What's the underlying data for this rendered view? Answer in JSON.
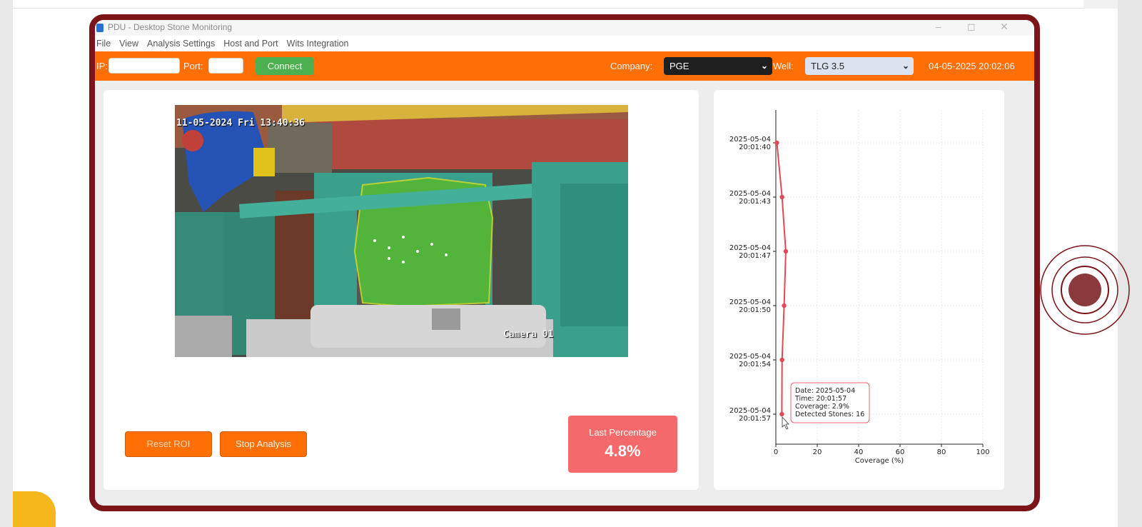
{
  "window": {
    "title": "PDU - Desktop Stone Monitoring"
  },
  "menu": [
    "File",
    "View",
    "Analysis Settings",
    "Host and Port",
    "Wits Integration"
  ],
  "connection": {
    "ip_label": "IP:",
    "ip_value": "",
    "port_label": "Port:",
    "port_value": "",
    "connect_label": "Connect"
  },
  "company": {
    "label": "Company:",
    "value": "PGE"
  },
  "well": {
    "label": "Well:",
    "value": "TLG 3.5"
  },
  "datetime": "04-05-2025 20:02:06",
  "camera": {
    "timestamp": "11-05-2024 Fri 13:40:36",
    "label": "Camera 01"
  },
  "buttons": {
    "reset_roi": "Reset ROI",
    "stop_analysis": "Stop Analysis"
  },
  "last_percentage": {
    "title": "Last Percentage",
    "value": "4.8%"
  },
  "colors": {
    "toolbar": "#ff6f06",
    "frame": "#7a1418",
    "connect": "#4caf50",
    "last_pct": "#f46a6a",
    "line": "#e04a55"
  },
  "chart_data": {
    "type": "line",
    "orientation": "horizontal-time-vertical",
    "xlabel": "Coverage (%)",
    "xlim": [
      0,
      100
    ],
    "x_ticks": [
      0,
      20,
      40,
      60,
      80,
      100
    ],
    "y_ticks": [
      "2025-05-04\n20:01:40",
      "2025-05-04\n20:01:43",
      "2025-05-04\n20:01:47",
      "2025-05-04\n20:01:50",
      "2025-05-04\n20:01:54",
      "2025-05-04\n20:01:57"
    ],
    "series": [
      {
        "points": [
          {
            "time": "2025-05-04 20:01:40",
            "coverage": 0.5
          },
          {
            "time": "2025-05-04 20:01:43",
            "coverage": 3.0
          },
          {
            "time": "2025-05-04 20:01:47",
            "coverage": 4.8
          },
          {
            "time": "2025-05-04 20:01:50",
            "coverage": 4.0
          },
          {
            "time": "2025-05-04 20:01:54",
            "coverage": 3.0
          },
          {
            "time": "2025-05-04 20:01:57",
            "coverage": 2.9
          }
        ]
      }
    ],
    "grid": true,
    "tooltip": {
      "lines": [
        "Date: 2025-05-04",
        "Time: 20:01:57",
        "Coverage: 2.9%",
        "Detected Stones: 16"
      ]
    }
  }
}
